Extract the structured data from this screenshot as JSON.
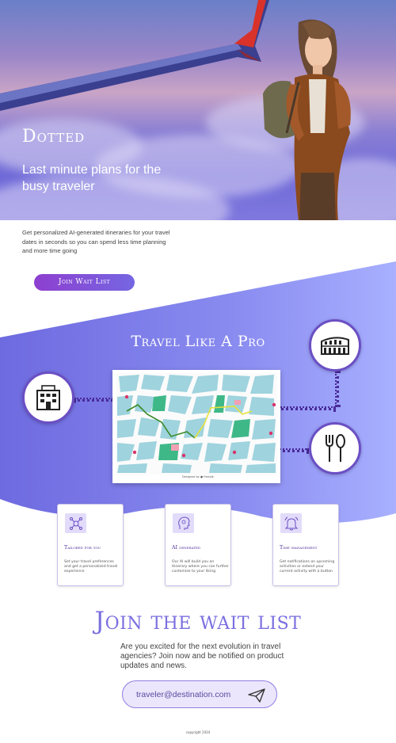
{
  "hero": {
    "brand": "Dotted",
    "tagline": "Last minute plans for the busy traveler"
  },
  "intro": {
    "text": "Get personalized AI-generated itineraries for your travel dates in seconds so you can spend less time planning and more time going"
  },
  "cta": {
    "join_label": "Join Wait List"
  },
  "section": {
    "title": "Travel Like A Pro",
    "map_credit": "Designed by ● Freepik"
  },
  "icons": {
    "hotel": "hotel-icon",
    "landmark": "colosseum-icon",
    "food": "fork-spoon-icon"
  },
  "features": [
    {
      "title": "Tailored for you",
      "text": "Set your travel preferences and get a personalized travel experience",
      "icon": "network-icon"
    },
    {
      "title": "AI generated",
      "text": "Our AI will build you an itinerary where you can further customize to your liking",
      "icon": "ai-head-icon"
    },
    {
      "title": "Time management",
      "text": "Get notifications on upcoming activities or extend your current activity with a button",
      "icon": "bell-icon"
    }
  ],
  "waitlist": {
    "title": "Join the wait list",
    "text": "Are you excited for the next evolution in travel agencies? Join now and be notified on product updates and news.",
    "email_placeholder": "traveler@destination.com"
  },
  "footer": {
    "copyright": "copyright 2024"
  },
  "colors": {
    "accent": "#6b4fc4",
    "band_start": "#6e6ae0",
    "band_end": "#a8b0ff",
    "cta_start": "#8e3fcf",
    "cta_end": "#7566e2"
  }
}
